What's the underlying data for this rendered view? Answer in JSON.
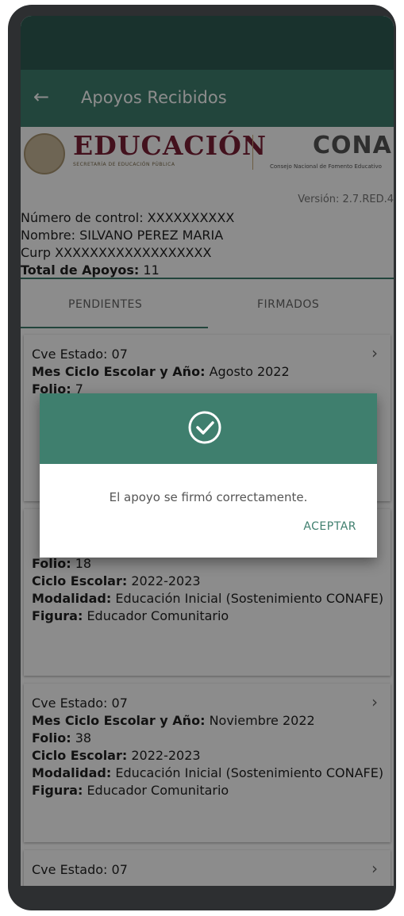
{
  "app": {
    "title": "Apoyos Recibidos",
    "accent_color": "#3f7f6e",
    "statusbar_color": "#2f5c52"
  },
  "header": {
    "logo_main": "EDUCACIÓN",
    "logo_sub": "SECRETARÍA DE EDUCACIÓN PÚBLICA",
    "conafe_logo": "CONAFE",
    "conafe_sub": "Consejo Nacional de Fomento Educativo",
    "version": "Versión: 2.7.RED.4"
  },
  "info": {
    "numero_label": "Número de control:",
    "numero_value": "XXXXXXXXXX",
    "nombre_label": "Nombre:",
    "nombre_value": "SILVANO PEREZ MARIA",
    "curp_label": "Curp",
    "curp_value": "XXXXXXXXXXXXXXXXXX",
    "total_label": "Total de Apoyos:",
    "total_value": "11"
  },
  "tabs": {
    "pendientes": "PENDIENTES",
    "firmados": "FIRMADOS"
  },
  "cards": [
    {
      "estado_label": "Cve Estado:",
      "estado_value": "07",
      "mes_label": "Mes Ciclo Escolar y Año:",
      "mes_value": "Agosto 2022",
      "folio_label": "Folio:",
      "folio_value": "7"
    },
    {
      "folio_label": "Folio:",
      "folio_value": "18",
      "ciclo_label": "Ciclo Escolar:",
      "ciclo_value": "2022-2023",
      "modalidad_label": "Modalidad:",
      "modalidad_value": "Educación Inicial (Sostenimiento CONAFE)",
      "figura_label": "Figura:",
      "figura_value": "Educador Comunitario"
    },
    {
      "estado_label": "Cve Estado:",
      "estado_value": "07",
      "mes_label": "Mes Ciclo Escolar y Año:",
      "mes_value": "Noviembre 2022",
      "folio_label": "Folio:",
      "folio_value": "38",
      "ciclo_label": "Ciclo Escolar:",
      "ciclo_value": "2022-2023",
      "modalidad_label": "Modalidad:",
      "modalidad_value": "Educación Inicial (Sostenimiento CONAFE)",
      "figura_label": "Figura:",
      "figura_value": "Educador Comunitario"
    },
    {
      "estado_label": "Cve Estado:",
      "estado_value": "07"
    }
  ],
  "dialog": {
    "message": "El apoyo se firmó correctamente.",
    "button": "ACEPTAR"
  }
}
